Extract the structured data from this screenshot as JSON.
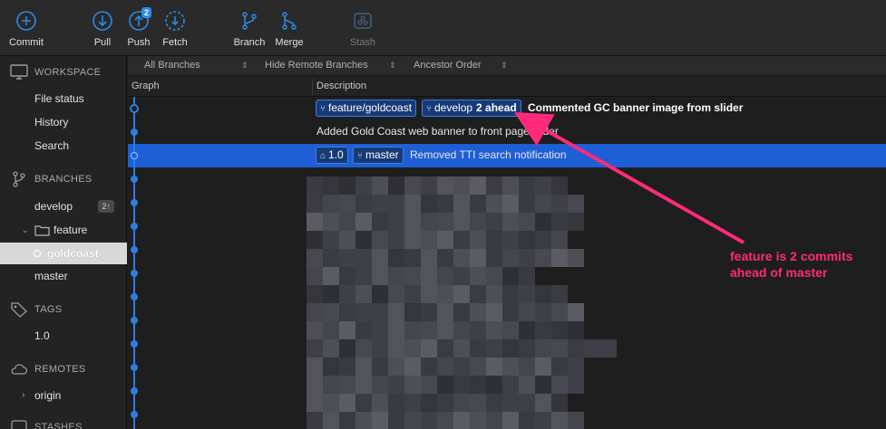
{
  "toolbar": {
    "commit": "Commit",
    "pull": "Pull",
    "push": "Push",
    "push_badge": "2",
    "fetch": "Fetch",
    "branch": "Branch",
    "merge": "Merge",
    "stash": "Stash",
    "accent": "#2d8ae6"
  },
  "sidebar": {
    "workspace": "WORKSPACE",
    "file_status": "File status",
    "history": "History",
    "search": "Search",
    "branches": "BRANCHES",
    "develop": "develop",
    "develop_badge": "2↑",
    "feature": "feature",
    "goldcoast": "goldcoast",
    "master": "master",
    "tags": "TAGS",
    "tag_1_0": "1.0",
    "remotes": "REMOTES",
    "origin": "origin",
    "stashes": "STASHES"
  },
  "filters": {
    "branches": "All Branches",
    "remote": "Hide Remote Branches",
    "order": "Ancestor Order"
  },
  "columns": {
    "graph": "Graph",
    "description": "Description"
  },
  "commits": [
    {
      "tags": [
        "feature/goldcoast",
        "develop"
      ],
      "ahead": "2 ahead",
      "message": "Commented GC banner image from slider"
    },
    {
      "message": "Added Gold Coast web banner to front page slider"
    },
    {
      "tags": [
        "1.0",
        "master"
      ],
      "message": "Removed TTI search notification"
    }
  ],
  "annotation": {
    "line1": "feature is 2 commits",
    "line2": "ahead of master",
    "color": "#ff2b7a"
  },
  "colors": {
    "selection": "#1e5fd6",
    "graph": "#2d7fe0"
  }
}
